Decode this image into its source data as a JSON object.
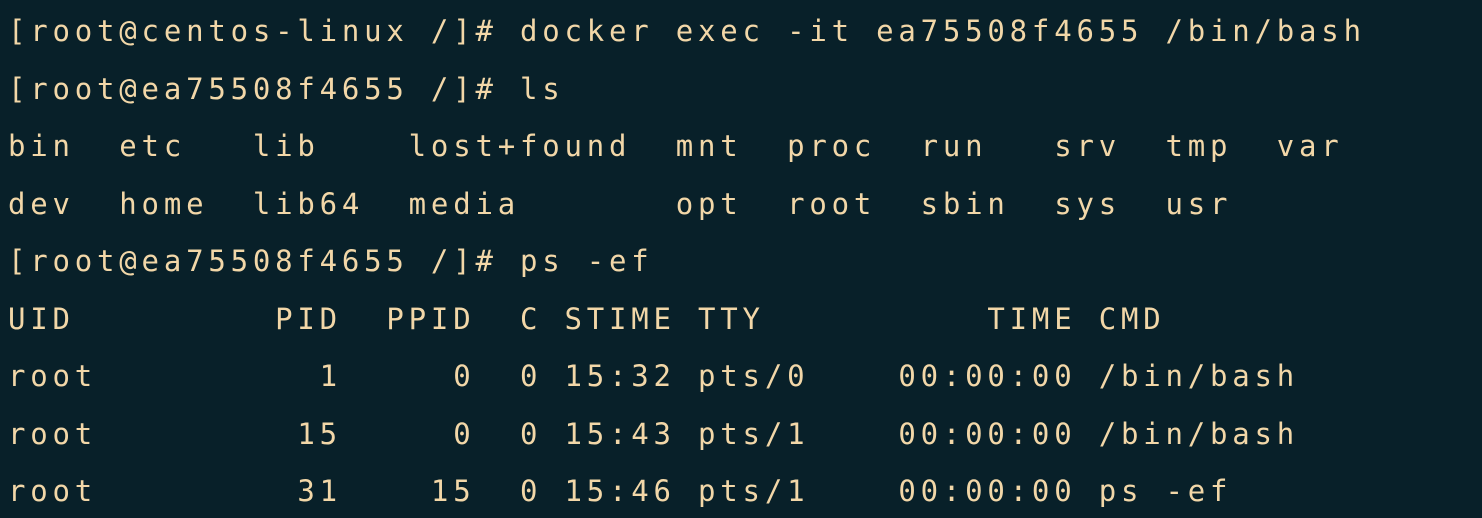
{
  "terminal": {
    "lines": [
      "[root@centos-linux /]# docker exec -it ea75508f4655 /bin/bash",
      "[root@ea75508f4655 /]# ls",
      "bin  etc   lib    lost+found  mnt  proc  run   srv  tmp  var",
      "dev  home  lib64  media       opt  root  sbin  sys  usr",
      "[root@ea75508f4655 /]# ps -ef",
      "UID         PID  PPID  C STIME TTY          TIME CMD",
      "root          1     0  0 15:32 pts/0    00:00:00 /bin/bash",
      "root         15     0  0 15:43 pts/1    00:00:00 /bin/bash",
      "root         31    15  0 15:46 pts/1    00:00:00 ps -ef"
    ]
  }
}
